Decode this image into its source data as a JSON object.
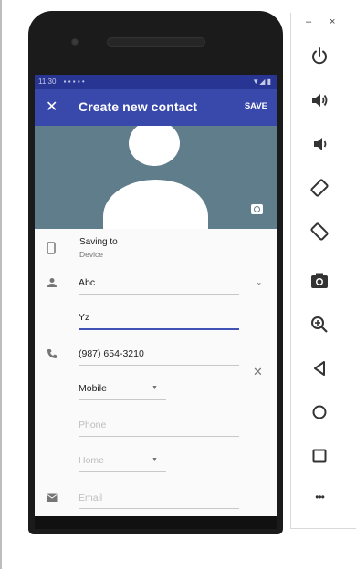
{
  "statusbar": {
    "time": "11:30",
    "icons": "▪ ▪ ▪ ▪  •",
    "right": "▼◢ ▮"
  },
  "appbar": {
    "close_label": "✕",
    "title": "Create new contact",
    "save_label": "SAVE"
  },
  "saving": {
    "title": "Saving to",
    "subtitle": "Device"
  },
  "name_fields": {
    "first": "Abc",
    "second": "Yz"
  },
  "phone": {
    "value": "(987) 654-3210",
    "type": "Mobile",
    "placeholder": "Phone",
    "type2": "Home"
  },
  "email": {
    "placeholder": "Email"
  },
  "window_controls": {
    "minimize": "–",
    "close": "×"
  },
  "side_panel_icons": [
    "power-icon",
    "volume-up-icon",
    "volume-down-icon",
    "rotate-left-icon",
    "rotate-right-icon",
    "screenshot-camera-icon",
    "zoom-in-icon",
    "back-icon",
    "home-icon",
    "overview-icon",
    "more-icon"
  ],
  "colors": {
    "appbar": "#3949ab",
    "statusbar": "#283593",
    "photo_bg": "#607d8b",
    "accent": "#3f51b5"
  },
  "more_label": "•••"
}
